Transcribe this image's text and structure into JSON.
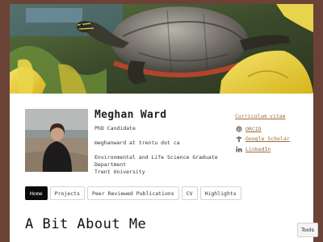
{
  "profile": {
    "name": "Meghan Ward",
    "role": "PhD Candidate",
    "email": "meghanward at trentu dot ca",
    "department": "Environmental and Life Science Graduate Department",
    "university": "Trent University"
  },
  "links": {
    "cv": "Curriculum vitae",
    "orcid": "ORCID",
    "scholar": "Google Scholar",
    "linkedin": "LinkedIn"
  },
  "nav": {
    "tabs": [
      "Home",
      "Projects",
      "Peer Reviewed Publications",
      "CV",
      "Highlights"
    ],
    "active": "Home"
  },
  "main": {
    "heading": "A Bit About Me"
  },
  "tools": {
    "label": "Tools"
  },
  "colors": {
    "page_border": "#6b4336",
    "link": "#9b6a3b",
    "active_tab": "#0b0b0b"
  }
}
